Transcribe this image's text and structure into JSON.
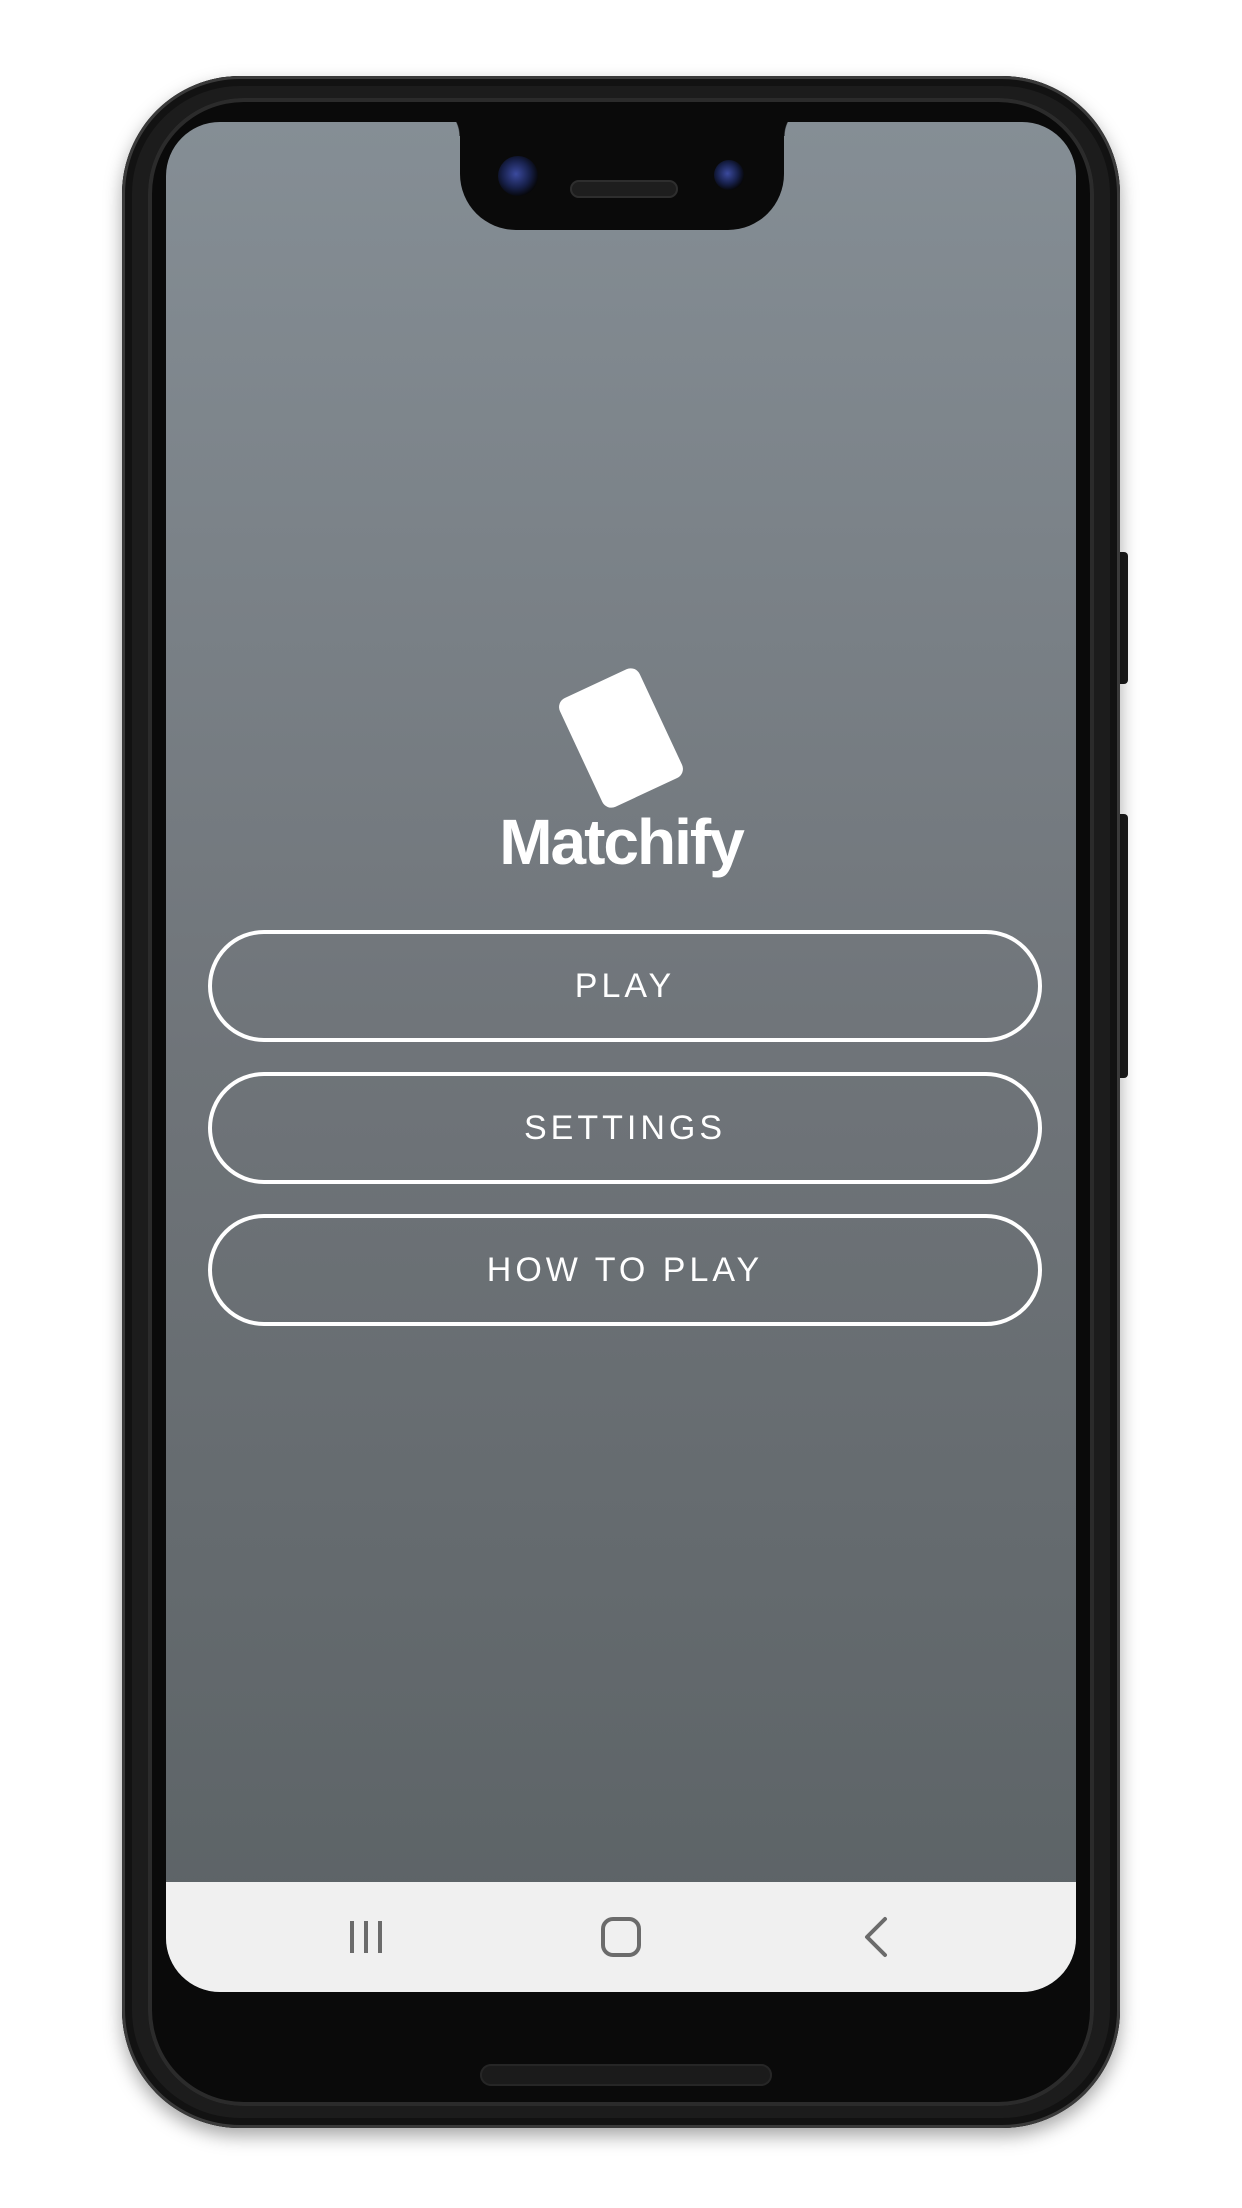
{
  "app": {
    "title": "Matchify",
    "logo_icon": "card-icon"
  },
  "menu": {
    "play_label": "PLAY",
    "settings_label": "SETTINGS",
    "how_to_play_label": "HOW TO PLAY"
  },
  "navbar": {
    "recents_icon": "recents-icon",
    "home_icon": "home-icon",
    "back_icon": "back-icon"
  },
  "colors": {
    "background_top": "#858e95",
    "background_bottom": "#5b6265",
    "button_border": "#ffffff",
    "text": "#ffffff",
    "navbar": "#f0f0f0"
  }
}
